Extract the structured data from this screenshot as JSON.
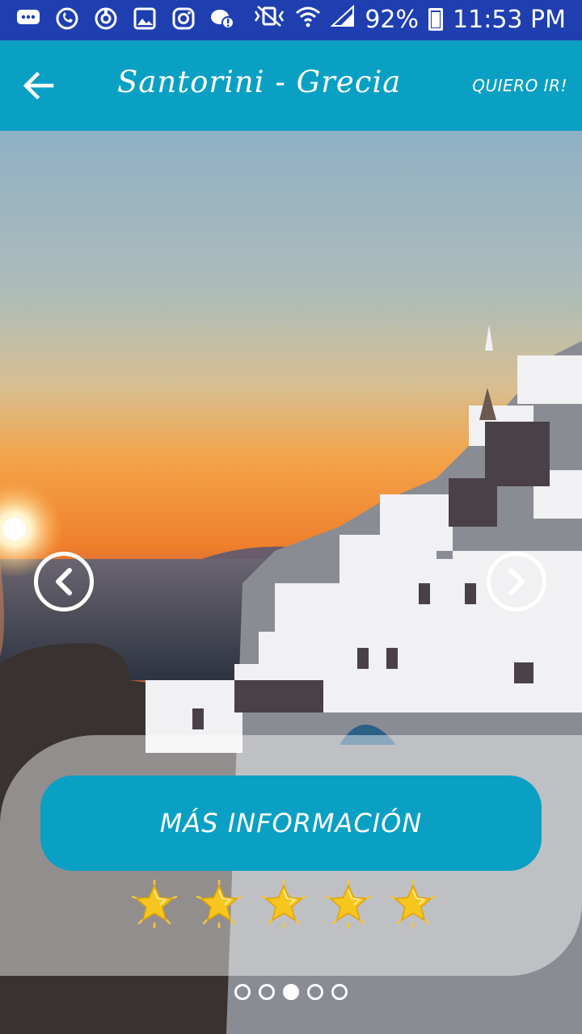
{
  "status_bar": {
    "icons": [
      "chat-bubble-icon",
      "whatsapp-icon",
      "sync-icon",
      "gallery-icon",
      "instagram-icon",
      "chat-alert-icon"
    ],
    "right_icons": [
      "vibrate-icon",
      "wifi-icon",
      "signal-icon"
    ],
    "battery": "92%",
    "time": "11:53 PM"
  },
  "toolbar": {
    "title": "Santorini - Grecia",
    "action": "QUIERO IR!",
    "back_icon": "arrow-left-icon"
  },
  "colors": {
    "status_bar": "#1f3fb0",
    "toolbar": "#0aa0c4",
    "button": "#0aa0c4"
  },
  "carousel": {
    "prev_icon": "chevron-left-icon",
    "next_icon": "chevron-right-icon",
    "page_count": 5,
    "active_page": 3
  },
  "info_button": "MÁS INFORMACIÓN",
  "rating": {
    "stars": 5,
    "icon": "star-icon"
  }
}
